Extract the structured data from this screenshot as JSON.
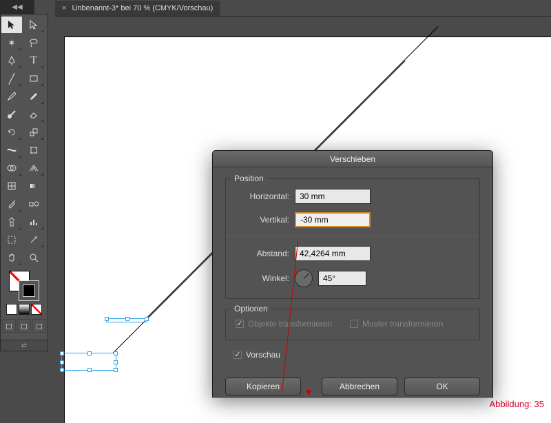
{
  "tab": {
    "close": "×",
    "title": "Unbenannt-3* bei 70 % (CMYK/Vorschau)"
  },
  "dialog": {
    "title": "Verschieben",
    "position_group": "Position",
    "horizontal_label": "Horizontal:",
    "horizontal_value": "30 mm",
    "vertical_label": "Vertikal:",
    "vertical_value": "-30 mm",
    "distance_label": "Abstand:",
    "distance_value": "42,4264 mm",
    "angle_label": "Winkel:",
    "angle_value": "45°",
    "options_group": "Optionen",
    "transform_objects": "Objekte transformieren",
    "transform_patterns": "Muster transformieren",
    "preview": "Vorschau",
    "copy": "Kopieren",
    "cancel": "Abbrechen",
    "ok": "OK"
  },
  "caption": "Abbildung: 35"
}
